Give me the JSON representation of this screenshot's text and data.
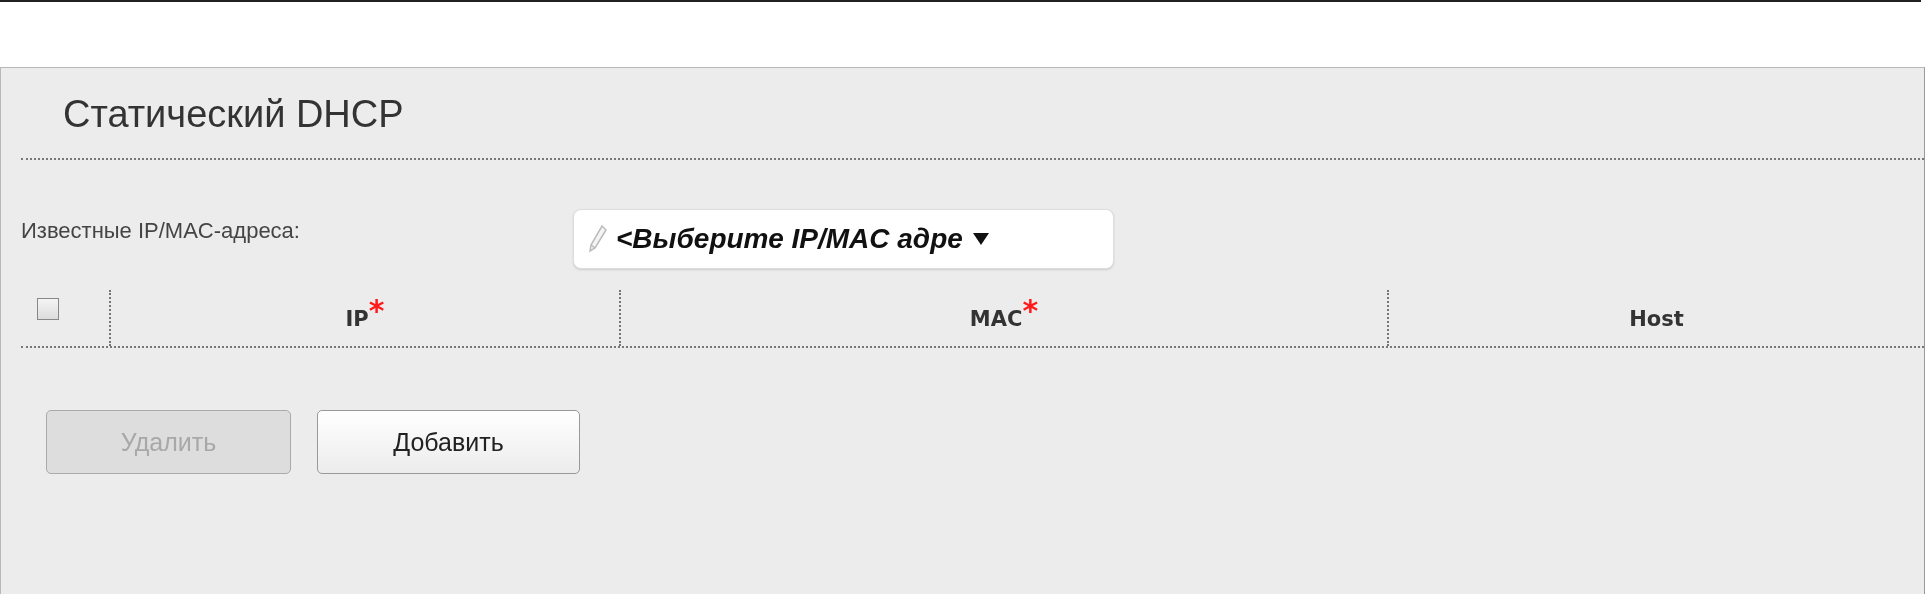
{
  "section": {
    "title": "Статический DHCP"
  },
  "known_addresses": {
    "label": "Известные IP/MAC-адреса:",
    "value": "<Выберите IP/MAC адре"
  },
  "table": {
    "select_all": {
      "checked": false
    },
    "columns": [
      {
        "label": "IP",
        "required_mark": "*"
      },
      {
        "label": "MAC",
        "required_mark": "*"
      },
      {
        "label": "Host"
      }
    ]
  },
  "buttons": [
    {
      "label": "Удалить",
      "disabled": true
    },
    {
      "label": "Добавить",
      "disabled": false
    }
  ]
}
